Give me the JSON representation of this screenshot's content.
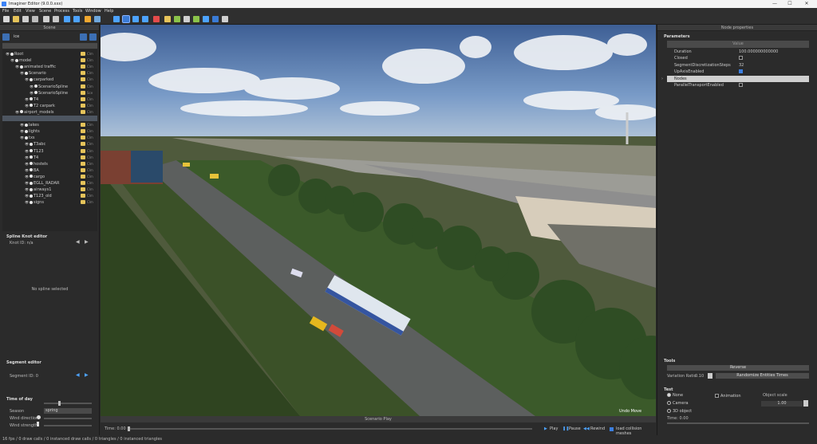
{
  "window": {
    "title": "Imaginer Editor (9.0.0.xxx)",
    "min": "—",
    "max": "☐",
    "close": "✕"
  },
  "menu": [
    "File",
    "Edit",
    "View",
    "Scene",
    "Process",
    "Tools",
    "Window",
    "Help"
  ],
  "left": {
    "scene_title": "Scene",
    "search_value": "ice",
    "tree": [
      {
        "label": "Root",
        "depth": 0
      },
      {
        "label": "model",
        "depth": 1
      },
      {
        "label": "animated traffic",
        "depth": 2
      },
      {
        "label": "Scenario",
        "depth": 3
      },
      {
        "label": "carparked",
        "depth": 4
      },
      {
        "label": "ScenarioSpline",
        "depth": 5
      },
      {
        "label": "ScenarioSpline",
        "depth": 5
      },
      {
        "label": "T4",
        "depth": 4
      },
      {
        "label": "T2 carpark",
        "depth": 4
      },
      {
        "label": "airport_models",
        "depth": 2
      },
      {
        "label": "MML_models",
        "depth": 3
      },
      {
        "label": "lakes",
        "depth": 3
      },
      {
        "label": "lights",
        "depth": 3
      },
      {
        "label": "txs",
        "depth": 3
      },
      {
        "label": "T3abc",
        "depth": 4
      },
      {
        "label": "T123",
        "depth": 4
      },
      {
        "label": "T4",
        "depth": 4
      },
      {
        "label": "hostels",
        "depth": 4
      },
      {
        "label": "BA",
        "depth": 4
      },
      {
        "label": "cargo",
        "depth": 4
      },
      {
        "label": "EGLL_RADAR",
        "depth": 4
      },
      {
        "label": "airways1",
        "depth": 4
      },
      {
        "label": "T123_old",
        "depth": 4
      },
      {
        "label": "signs",
        "depth": 4
      }
    ],
    "tree_col": "Clm",
    "tree_col_sel": "Sce",
    "spline_knot_title": "Spline Knot editor",
    "knot_id": "Knot ID: n/a",
    "no_spline": "No spline selected",
    "segment_title": "Segment editor",
    "segment_id": "Segment ID: 0",
    "time_of_day_title": "Time of day",
    "season_label": "Season",
    "season_value": "spring",
    "wind_direction_label": "Wind direction",
    "wind_strength_label": "Wind strength"
  },
  "viewport": {
    "undo_label": "Undo Move",
    "status_label": "Scenario Play"
  },
  "timeline": {
    "time": "Time: 0.00 :s",
    "play": "Play",
    "pause": "Pause",
    "rewind": "Rewind",
    "load": "load collision meshes"
  },
  "right": {
    "title": "Node properties",
    "params_title": "Parameters",
    "value_header": "Value",
    "props": [
      {
        "name": "Duration",
        "value": "100.000000000000"
      },
      {
        "name": "Closed",
        "check": false
      },
      {
        "name": "SegmentDiscretizationSteps",
        "value": "32"
      },
      {
        "name": "UpAxisEnabled",
        "check": true
      },
      {
        "name": "Nodes",
        "selected": true
      },
      {
        "name": "ParallelTransportEnabled",
        "check": false
      }
    ],
    "tools_title": "Tools",
    "reverse": "Reverse",
    "variation_label": "Variation Ratio",
    "variation_value": "0.10",
    "randomize": "Randomize Entities Times",
    "test_title": "Test",
    "none_label": "None",
    "animation_label": "Animation",
    "object_scale_label": "Object scale",
    "camera_label": "Camera",
    "scale_value": "1.00",
    "object3d_label": "3D object",
    "time_label": "Time: 0.00"
  },
  "status": "16 fps / 0 draw calls / 0 instanced draw calls / 0 triangles / 0 instanced triangles"
}
